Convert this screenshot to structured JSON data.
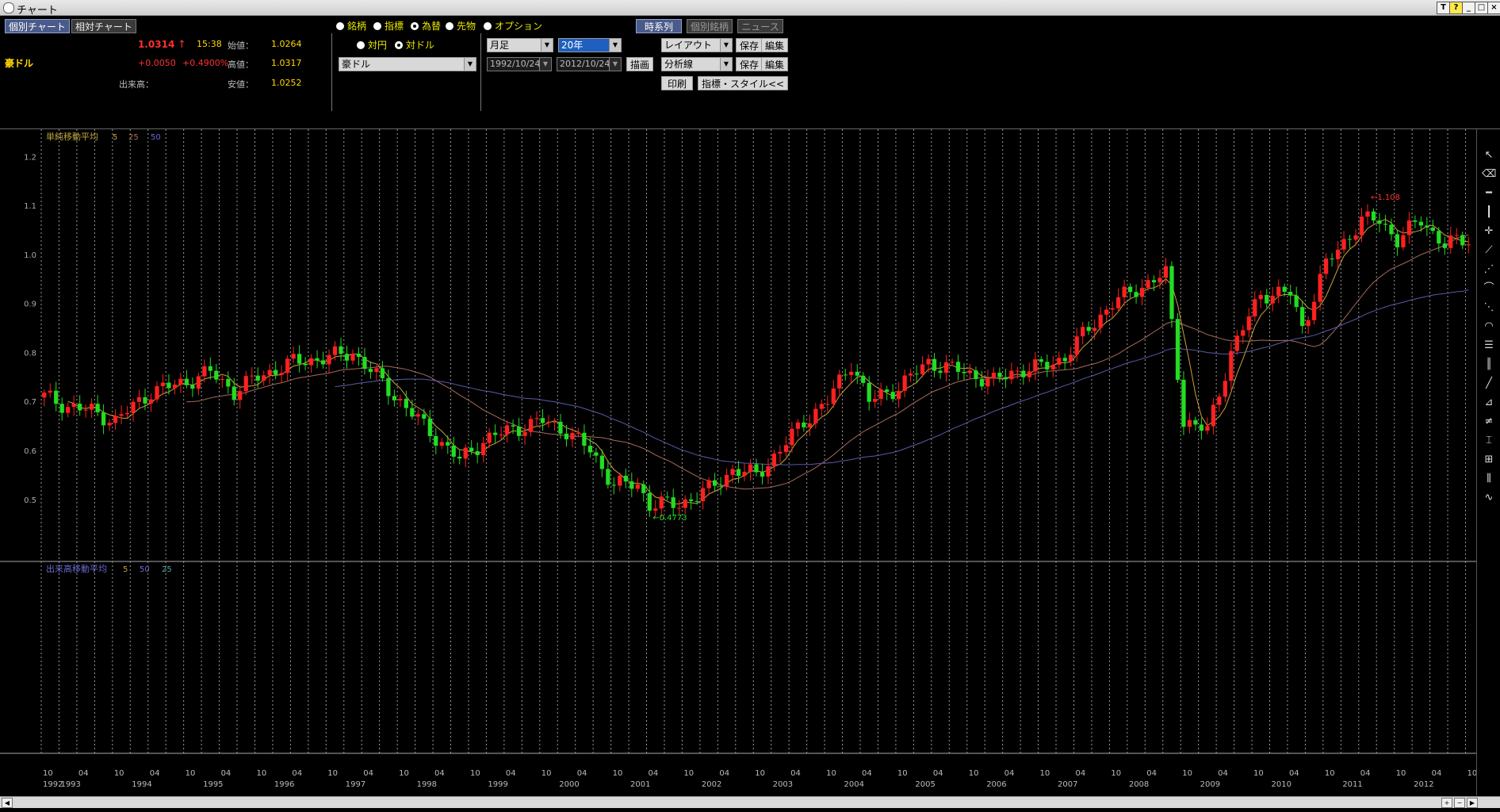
{
  "window": {
    "title": "チャート"
  },
  "top": {
    "tab_individual": "個別チャート",
    "tab_relative": "相対チャート",
    "symbol": "豪ドル",
    "price": "1.0314",
    "arrow": "↑",
    "time": "15:38",
    "change": "+0.0050",
    "change_pct": "+0.4900%",
    "open_label": "始値：",
    "open_value": "1.0264",
    "high_label": "高値：",
    "high_value": "1.0317",
    "low_label": "安値：",
    "low_value": "1.0252",
    "volume_label": "出来高："
  },
  "radios": {
    "r1": "銘柄",
    "r2": "指標",
    "r3": "為替",
    "r4": "先物",
    "r5": "オプション",
    "r6": "対円",
    "r7": "対ドル",
    "currency_select": "豪ドル"
  },
  "period": {
    "freq": "月足",
    "span": "20年",
    "from": "1992/10/24",
    "to": "2012/10/24",
    "draw": "描画"
  },
  "right_controls": {
    "timeseries": "時系列",
    "individual": "個別銘柄",
    "news": "ニュース",
    "layout": "レイアウト",
    "save": "保存",
    "edit": "編集",
    "analysis": "分析線",
    "print": "印刷",
    "style": "指標・スタイル<<"
  },
  "chart_data": {
    "type": "candlestick",
    "indicator_label": "単純移動平均",
    "ma_periods": [
      "5",
      "25",
      "50"
    ],
    "volume_label": "出来高移動平均",
    "vol_periods": [
      "5",
      "50",
      "25"
    ],
    "ylim": [
      0.43,
      1.22
    ],
    "yticks": [
      "1.2",
      "1.1",
      "1.0",
      "0.9",
      "0.8",
      "0.7",
      "0.6",
      "0.5"
    ],
    "high_marker": "1.108",
    "low_marker": "0.4773",
    "year_labels": [
      "1992",
      "1993",
      "1994",
      "1995",
      "1996",
      "1997",
      "1998",
      "1999",
      "2000",
      "2001",
      "2002",
      "2003",
      "2004",
      "2005",
      "2006",
      "2007",
      "2008",
      "2009",
      "2010",
      "2011",
      "2012"
    ],
    "start": "1992-10",
    "end": "2012-10",
    "up_color": "#ff2020",
    "down_color": "#22dd22",
    "ma_colors": [
      "#c9a23a",
      "#a66a5a",
      "#5a5aa8"
    ],
    "key_closes": [
      [
        "1992-10",
        0.71
      ],
      [
        "1993-02",
        0.69
      ],
      [
        "1993-06",
        0.68
      ],
      [
        "1993-10",
        0.66
      ],
      [
        "1994-04",
        0.72
      ],
      [
        "1994-10",
        0.74
      ],
      [
        "1995-02",
        0.76
      ],
      [
        "1995-06",
        0.72
      ],
      [
        "1995-10",
        0.75
      ],
      [
        "1996-04",
        0.78
      ],
      [
        "1996-10",
        0.79
      ],
      [
        "1997-02",
        0.8
      ],
      [
        "1997-06",
        0.75
      ],
      [
        "1997-10",
        0.7
      ],
      [
        "1998-02",
        0.65
      ],
      [
        "1998-08",
        0.58
      ],
      [
        "1998-12",
        0.62
      ],
      [
        "1999-04",
        0.64
      ],
      [
        "1999-10",
        0.66
      ],
      [
        "2000-02",
        0.64
      ],
      [
        "2000-06",
        0.6
      ],
      [
        "2000-10",
        0.53
      ],
      [
        "2001-02",
        0.53
      ],
      [
        "2001-04",
        0.49
      ],
      [
        "2001-09",
        0.49
      ],
      [
        "2002-02",
        0.52
      ],
      [
        "2002-06",
        0.56
      ],
      [
        "2002-10",
        0.55
      ],
      [
        "2003-02",
        0.6
      ],
      [
        "2003-06",
        0.66
      ],
      [
        "2003-10",
        0.7
      ],
      [
        "2004-02",
        0.78
      ],
      [
        "2004-05",
        0.7
      ],
      [
        "2004-10",
        0.73
      ],
      [
        "2005-03",
        0.78
      ],
      [
        "2005-09",
        0.76
      ],
      [
        "2006-02",
        0.74
      ],
      [
        "2006-05",
        0.76
      ],
      [
        "2006-10",
        0.77
      ],
      [
        "2007-02",
        0.79
      ],
      [
        "2007-06",
        0.85
      ],
      [
        "2007-10",
        0.9
      ],
      [
        "2008-02",
        0.93
      ],
      [
        "2008-07",
        0.96
      ],
      [
        "2008-10",
        0.66
      ],
      [
        "2009-02",
        0.64
      ],
      [
        "2009-06",
        0.8
      ],
      [
        "2009-11",
        0.92
      ],
      [
        "2010-04",
        0.92
      ],
      [
        "2010-06",
        0.85
      ],
      [
        "2010-10",
        0.98
      ],
      [
        "2011-04",
        1.07
      ],
      [
        "2011-07",
        1.07
      ],
      [
        "2011-10",
        1.03
      ],
      [
        "2012-02",
        1.07
      ],
      [
        "2012-06",
        1.02
      ],
      [
        "2012-10",
        1.031
      ]
    ]
  }
}
